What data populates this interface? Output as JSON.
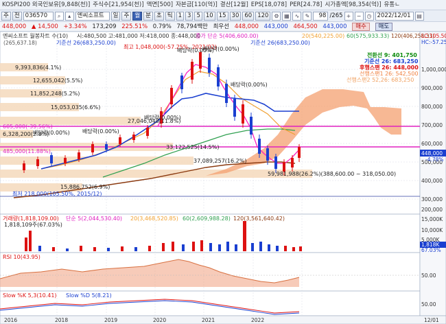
{
  "ticker_bar": {
    "items": [
      "KOSPI200 외국인보유[9,848(천)]",
      "주식수[21,954(천)]",
      "액면[500]",
      "자본금[110(억)]",
      "결산[12월]",
      "EPS[18,078]",
      "PER[24.78]",
      "시가총액[98,354(억)]",
      "유통ㄴ"
    ]
  },
  "toolbar": {
    "main_label": "주",
    "market": "전",
    "code": "036570",
    "name": "엔씨소프트",
    "periods": [
      "일",
      "주",
      "월",
      "분",
      "초",
      "틱"
    ],
    "selected_period": "월",
    "n1": "1",
    "n2": "3",
    "n3": "5",
    "n4": "10",
    "n5": "15",
    "n6": "30",
    "n7": "60",
    "n8": "120",
    "count": "98",
    "total": "/265",
    "date": "2022/12/01"
  },
  "price_bar": {
    "price": "448,000",
    "change": "▲ 14,500",
    "change_pct": "+3.34%",
    "volume": "173,209",
    "turnover": "225.51%",
    "ratio": "0.79%",
    "amount": "78,794백만",
    "high_label": "최우선",
    "bid": "448,000",
    "ask": "443,000",
    "ask2": "464,500",
    "bid2": "443,000",
    "buy": "매수",
    "sell": "매도"
  },
  "price_panel": {
    "header_title": "엔씨소프트 월봉차트 수(10)",
    "header_ohlc": "시:480,500 고:481,000 저:418,000 종:448,000",
    "header_ma_label": "종가 단순 5(406,600.00)",
    "header_ma20": "20(540,225.00)",
    "header_ma60": "60(575,933.33)",
    "header_ma120": "120(406,258.33)",
    "ichimoku_line": "기준선 26(683,250.00)",
    "ichimoku_line2": "기준선 26(683,250.00)",
    "high_note": "최고 1,048,000(-57.25%, 2021/02)",
    "low_note": "최저 218,000(105.50%, 2015/12)",
    "lc_label": "LC:105.50",
    "hc_label": "HC:-57.25",
    "right_pct": "-4.78%",
    "price_tag": "448,000",
    "legend": [
      {
        "label": "전환선 9: 401,750",
        "color": "#0a8a0a"
      },
      {
        "label": "기준선 26: 683,250",
        "color": "#1a3fd0"
      },
      {
        "label": "후행스팬 26: 448,000",
        "color": "#d11"
      },
      {
        "label": "선행스팬1 26: 542,500",
        "color": "#f08040"
      },
      {
        "label": "선행스팬2 52,26: 683,250",
        "color": "#f0a060"
      }
    ],
    "volume_profile": [
      "9,393,836(4.1%)",
      "12,655,042(5.5%)",
      "11,852,248(5.2%)",
      "15,053,035(6.6%)",
      "27,046,048(11.8%)",
      "6,328,200(2.8%)",
      "33,122,525(14.5%)",
      "37,089,257(16.2%)",
      "59,981,988(26.2%)(388,600.00 ~ 318,050.00)",
      "15,886,752(6.9%)"
    ],
    "dividends": [
      "배당락(0.00%)",
      "배당락(0.00%)",
      "배당락(0.00%)",
      "배당락(0.00%)",
      "배당락(0.00%)",
      "배당락(0.00%)"
    ],
    "left_marks": [
      "605,000(-39.56%)",
      "485,000(11.88%)",
      "(265,637.18)"
    ],
    "y_ticks": [
      "1,000,000",
      "900,000",
      "800,000",
      "700,000",
      "600,000",
      "500,000",
      "400,000",
      "300,000",
      "200,000"
    ]
  },
  "volume_panel": {
    "header": "거래량(1,818,109.00)",
    "header_ma5": "단순 5(2,044,530.40)",
    "header_ma20": "20(3,468,520.85)",
    "header_ma60": "60(2,609,988.28)",
    "header_ma120": "120(3,561,640.42)",
    "sub_label": "1,818,109주(67.03%)",
    "y_ticks": [
      "15,000K",
      "10,000K",
      "5,000K"
    ],
    "right_tag": "1,818K",
    "right_pct": "67.03%"
  },
  "rsi_panel": {
    "header": "RSI 10(43.95)",
    "y_ticks": [
      "50.00"
    ],
    "right_tag": "43.95"
  },
  "stoch_panel": {
    "header": "Slow %K 5,3(10.41)",
    "header_d": "Slow %D 5(8.21)",
    "y_ticks": [
      "50.00"
    ]
  },
  "x_axis": {
    "labels": [
      "2016",
      "2018",
      "2019",
      "2020",
      "2021",
      "2022",
      "12/01"
    ]
  },
  "colors": {
    "up": "#e02020",
    "down": "#1a3fd0",
    "cloud": "#f4a070",
    "bg": "#ffffff"
  }
}
